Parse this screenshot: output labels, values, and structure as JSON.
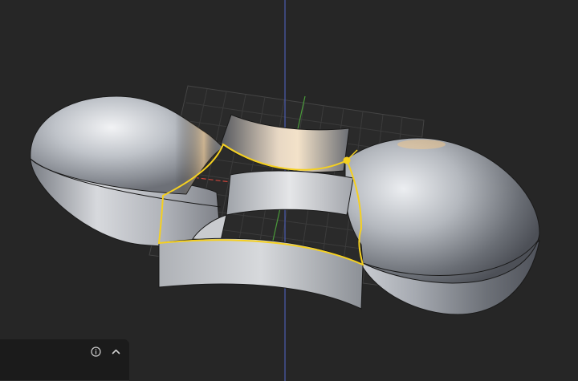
{
  "viewport": {
    "background": "#262626",
    "axis_colors": {
      "x": "#c9443b",
      "y": "#4a9a3a",
      "z": "#4a5bb0"
    },
    "selection_color": "#f5d020",
    "objects": [
      {
        "name": "left-dome-shell"
      },
      {
        "name": "right-dome-shell"
      },
      {
        "name": "front-curved-wall"
      },
      {
        "name": "back-curved-wall"
      },
      {
        "name": "selected-face-outline"
      }
    ]
  },
  "operator_panel": {
    "title": "",
    "icons": {
      "info": "info-circle-icon",
      "collapse": "chevron-up-icon"
    }
  }
}
